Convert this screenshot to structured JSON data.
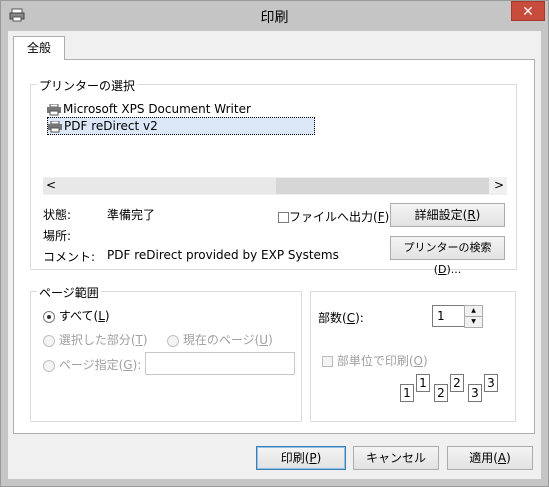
{
  "window": {
    "title": "印刷",
    "close_glyph": "✕"
  },
  "tab": {
    "label": "全般"
  },
  "printer_group": {
    "legend": "プリンターの選択",
    "printers": [
      {
        "name": "Microsoft XPS Document Writer",
        "selected": false
      },
      {
        "name": "PDF reDirect v2",
        "selected": true
      }
    ],
    "scroll_left": "<",
    "scroll_right": ">"
  },
  "status": {
    "state_label": "状態:",
    "state_value": "準備完了",
    "location_label": "場所:",
    "location_value": "",
    "comment_label": "コメント:",
    "comment_value": "PDF reDirect provided by EXP Systems"
  },
  "print_to_file": {
    "label_main": "ファイルへ出力(",
    "accel": "F",
    "label_end": ")",
    "checked": false
  },
  "buttons": {
    "preferences_main": "詳細設定(",
    "preferences_accel": "R",
    "preferences_end": ")",
    "find_main": "プリンターの検索(",
    "find_accel": "D",
    "find_end": ")...",
    "print_main": "印刷(",
    "print_accel": "P",
    "print_end": ")",
    "cancel": "キャンセル",
    "apply_main": "適用(",
    "apply_accel": "A",
    "apply_end": ")"
  },
  "page_range": {
    "legend": "ページ範囲",
    "all_main": "すべて(",
    "all_accel": "L",
    "all_end": ")",
    "selection_main": "選択した部分(",
    "selection_accel": "T",
    "selection_end": ")",
    "current_main": "現在のページ(",
    "current_accel": "U",
    "current_end": ")",
    "pages_main": "ページ指定(",
    "pages_accel": "G",
    "pages_end": "):",
    "pages_value": ""
  },
  "copies": {
    "label_main": "部数(",
    "label_accel": "C",
    "label_end": "):",
    "value": "1",
    "collate_main": "部単位で印刷(",
    "collate_accel": "O",
    "collate_end": ")",
    "collate_checked": false,
    "collate_illustration": [
      "1",
      "1",
      "2",
      "2",
      "3",
      "3"
    ]
  }
}
